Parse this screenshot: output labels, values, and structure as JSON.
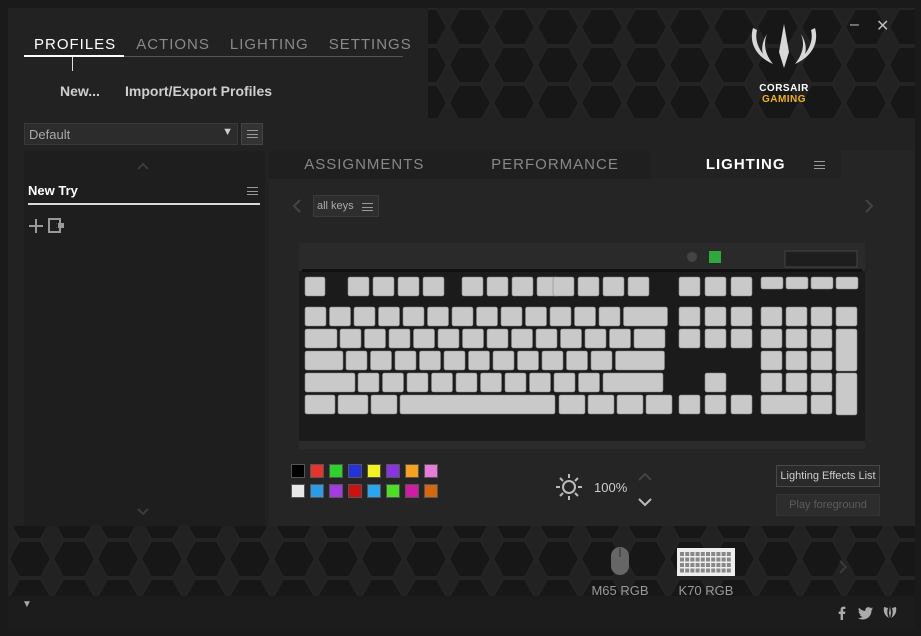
{
  "topnav": {
    "profiles": "PROFILES",
    "actions": "ACTIONS",
    "lighting": "LIGHTING",
    "settings": "SETTINGS"
  },
  "subnav": {
    "new": "New...",
    "import_export": "Import/Export Profiles"
  },
  "window": {
    "minimize": "–",
    "close": "✕"
  },
  "logo": {
    "line1": "CORSAIR",
    "line2": "GAMING"
  },
  "profile_select": {
    "value": "Default",
    "arrow": "▼"
  },
  "profiles": {
    "items": [
      {
        "name": "New Try"
      }
    ]
  },
  "tabs": {
    "assignments": "ASSIGNMENTS",
    "performance": "PERFORMANCE",
    "lighting": "LIGHTING"
  },
  "keys_select": {
    "value": "all keys"
  },
  "palette": {
    "row1": [
      "#000000",
      "#e8322c",
      "#2cd12c",
      "#2233dd",
      "#f2f21c",
      "#8a33e0",
      "#f6a21c",
      "#e87ad8"
    ],
    "row2": [
      "#e8e8e8",
      "#2a9be8",
      "#a33be0",
      "#cc1111",
      "#2aa6f0",
      "#4adf22",
      "#d11ba3",
      "#d5670e"
    ]
  },
  "brightness": {
    "value": "100%"
  },
  "buttons": {
    "lighting_effects_list": "Lighting Effects List",
    "play_foreground": "Play foreground"
  },
  "devices": [
    {
      "name": "M65 RGB"
    },
    {
      "name": "K70 RGB"
    }
  ],
  "footer": {
    "dropdown": "▼"
  },
  "colors": {
    "accent": "#f2b21a",
    "active_text": "#ffffff",
    "inactive_text": "#8a8a8a"
  }
}
